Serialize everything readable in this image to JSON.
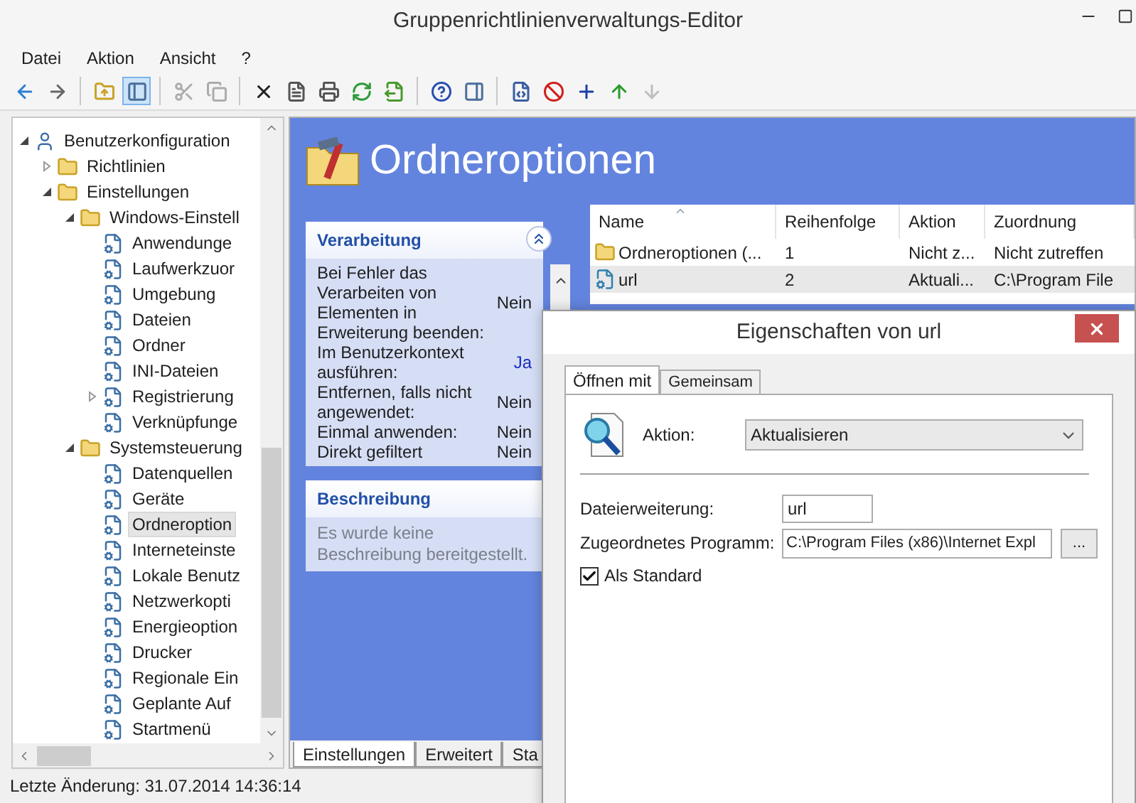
{
  "window": {
    "title": "Gruppenrichtlinienverwaltungs-Editor"
  },
  "menu": [
    "Datei",
    "Aktion",
    "Ansicht",
    "?"
  ],
  "toolbar": [
    {
      "kind": "back",
      "pressed": false,
      "disabled": false
    },
    {
      "kind": "forward",
      "pressed": false,
      "disabled": false
    },
    {
      "kind": "separator"
    },
    {
      "kind": "up",
      "pressed": false,
      "disabled": false
    },
    {
      "kind": "tree",
      "pressed": true,
      "disabled": false
    },
    {
      "kind": "separator"
    },
    {
      "kind": "cut",
      "pressed": false,
      "disabled": true
    },
    {
      "kind": "copy",
      "pressed": false,
      "disabled": true
    },
    {
      "kind": "separator"
    },
    {
      "kind": "delete",
      "pressed": false,
      "disabled": false
    },
    {
      "kind": "properties",
      "pressed": false,
      "disabled": false
    },
    {
      "kind": "print",
      "pressed": false,
      "disabled": false
    },
    {
      "kind": "refresh",
      "pressed": false,
      "disabled": false
    },
    {
      "kind": "export",
      "pressed": false,
      "disabled": false
    },
    {
      "kind": "separator"
    },
    {
      "kind": "help",
      "pressed": false,
      "disabled": false
    },
    {
      "kind": "pane",
      "pressed": false,
      "disabled": false
    },
    {
      "kind": "separator"
    },
    {
      "kind": "xml",
      "pressed": false,
      "disabled": false
    },
    {
      "kind": "stop",
      "pressed": false,
      "disabled": false
    },
    {
      "kind": "add",
      "pressed": false,
      "disabled": false
    },
    {
      "kind": "move-up",
      "pressed": false,
      "disabled": false
    },
    {
      "kind": "move-down",
      "pressed": false,
      "disabled": true
    }
  ],
  "tree": [
    {
      "label": "Benutzerkonfiguration",
      "kind": "user",
      "expanded": true,
      "selected": false,
      "children": [
        {
          "label": "Richtlinien",
          "kind": "folder",
          "expanded": false,
          "selected": false
        },
        {
          "label": "Einstellungen",
          "kind": "folder",
          "expanded": true,
          "selected": false,
          "children": [
            {
              "label": "Windows-Einstell",
              "kind": "folder",
              "expanded": true,
              "selected": false,
              "children": [
                {
                  "label": "Anwendunge",
                  "kind": "item",
                  "selected": false
                },
                {
                  "label": "Laufwerkzuor",
                  "kind": "item",
                  "selected": false
                },
                {
                  "label": "Umgebung",
                  "kind": "item",
                  "selected": false
                },
                {
                  "label": "Dateien",
                  "kind": "item",
                  "selected": false
                },
                {
                  "label": "Ordner",
                  "kind": "item",
                  "selected": false
                },
                {
                  "label": "INI-Dateien",
                  "kind": "item",
                  "selected": false
                },
                {
                  "label": "Registrierung",
                  "kind": "item",
                  "expanded": false,
                  "selected": false
                },
                {
                  "label": "Verknüpfunge",
                  "kind": "item",
                  "selected": false
                }
              ]
            },
            {
              "label": "Systemsteuerung",
              "kind": "folder",
              "expanded": true,
              "selected": false,
              "children": [
                {
                  "label": "Datenquellen",
                  "kind": "item",
                  "selected": false
                },
                {
                  "label": "Geräte",
                  "kind": "item",
                  "selected": false
                },
                {
                  "label": "Ordneroption",
                  "kind": "item",
                  "selected": true
                },
                {
                  "label": "Interneteinste",
                  "kind": "item",
                  "selected": false
                },
                {
                  "label": "Lokale Benutz",
                  "kind": "item",
                  "selected": false
                },
                {
                  "label": "Netzwerkopti",
                  "kind": "item",
                  "selected": false
                },
                {
                  "label": "Energieoption",
                  "kind": "item",
                  "selected": false
                },
                {
                  "label": "Drucker",
                  "kind": "item",
                  "selected": false
                },
                {
                  "label": "Regionale Ein",
                  "kind": "item",
                  "selected": false
                },
                {
                  "label": "Geplante Auf",
                  "kind": "item",
                  "selected": false
                },
                {
                  "label": "Startmenü",
                  "kind": "item",
                  "selected": false
                }
              ]
            }
          ]
        }
      ]
    }
  ],
  "details": {
    "title": "Ordneroptionen",
    "panels": [
      {
        "title": "Verarbeitung",
        "expanded": true,
        "rows": [
          {
            "label": "Bei Fehler das Verarbeiten von Elementen in Erweiterung beenden:",
            "value": "Nein",
            "changed": false
          },
          {
            "label": "Im Benutzerkontext ausführen:",
            "value": "Ja",
            "changed": true
          },
          {
            "label": "Entfernen, falls nicht angewendet:",
            "value": "Nein",
            "changed": false
          },
          {
            "label": "Einmal anwenden:",
            "value": "Nein",
            "changed": false
          },
          {
            "label": "Direkt gefiltert",
            "value": "Nein",
            "changed": false
          }
        ]
      },
      {
        "title": "Beschreibung",
        "text": "Es wurde keine Beschreibung bereitgestellt."
      }
    ]
  },
  "list": {
    "columns": [
      {
        "label": "Name",
        "sorted": true
      },
      {
        "label": "Reihenfolge",
        "sorted": false
      },
      {
        "label": "Aktion",
        "sorted": false
      },
      {
        "label": "Zuordnung",
        "sorted": false
      }
    ],
    "rows": [
      {
        "kind": "folder-options",
        "selected": false,
        "cells": [
          "Ordneroptionen (...",
          "1",
          "Nicht z...",
          "Nicht zutreffen"
        ]
      },
      {
        "kind": "file-type",
        "selected": true,
        "cells": [
          "url",
          "2",
          "Aktuali...",
          "C:\\Program File"
        ]
      }
    ]
  },
  "bottom_tabs": [
    {
      "label": "Einstellungen",
      "selected": true
    },
    {
      "label": "Erweitert",
      "selected": false
    },
    {
      "label": "Sta",
      "selected": false
    }
  ],
  "status_bar": "Letzte Änderung: 31.07.2014 14:36:14",
  "dialog": {
    "title": "Eigenschaften von url",
    "tabs": [
      {
        "label": "Öffnen mit",
        "selected": true
      },
      {
        "label": "Gemeinsam",
        "selected": false
      }
    ],
    "action": {
      "label": "Aktion:",
      "value": "Aktualisieren"
    },
    "fields": [
      {
        "kind": "short",
        "label": "Dateierweiterung:",
        "value": "url"
      },
      {
        "kind": "browse",
        "label": "Zugeordnetes Programm:",
        "value": "C:\\Program Files (x86)\\Internet Expl",
        "button": "..."
      }
    ],
    "default": {
      "label": "Als Standard",
      "checked": true
    }
  }
}
